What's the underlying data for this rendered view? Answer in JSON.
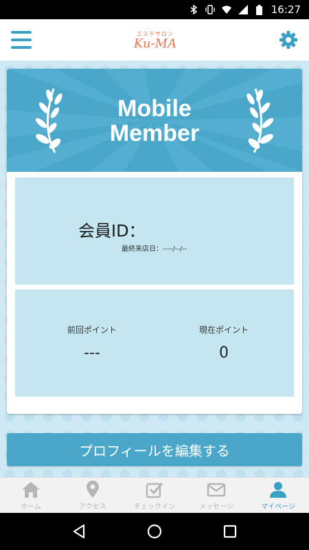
{
  "status_bar": {
    "time": "16:27",
    "icons": [
      "bluetooth-icon",
      "vibrate-icon",
      "wifi-icon",
      "cellular-icon",
      "battery-icon"
    ]
  },
  "header": {
    "logo_sub": "エステサロン",
    "logo_main": "Ku-MA",
    "accent_color": "#3aa0c6",
    "logo_color": "#e8734f"
  },
  "banner": {
    "line1": "Mobile",
    "line2": "Member"
  },
  "member": {
    "id_label": "会員ID：",
    "last_visit": "最終来店日：----/--/--"
  },
  "points": {
    "prev_label": "前回ポイント",
    "prev_value": "---",
    "curr_label": "現在ポイント",
    "curr_value": "0"
  },
  "edit_button": "プロフィールを編集する",
  "tabs": [
    {
      "label": "ホーム",
      "icon": "home-icon",
      "active": false
    },
    {
      "label": "アクセス",
      "icon": "map-pin-icon",
      "active": false
    },
    {
      "label": "チェックイン",
      "icon": "checkin-icon",
      "active": false
    },
    {
      "label": "メッセージ",
      "icon": "mail-icon",
      "active": false
    },
    {
      "label": "マイページ",
      "icon": "user-icon",
      "active": true
    }
  ]
}
